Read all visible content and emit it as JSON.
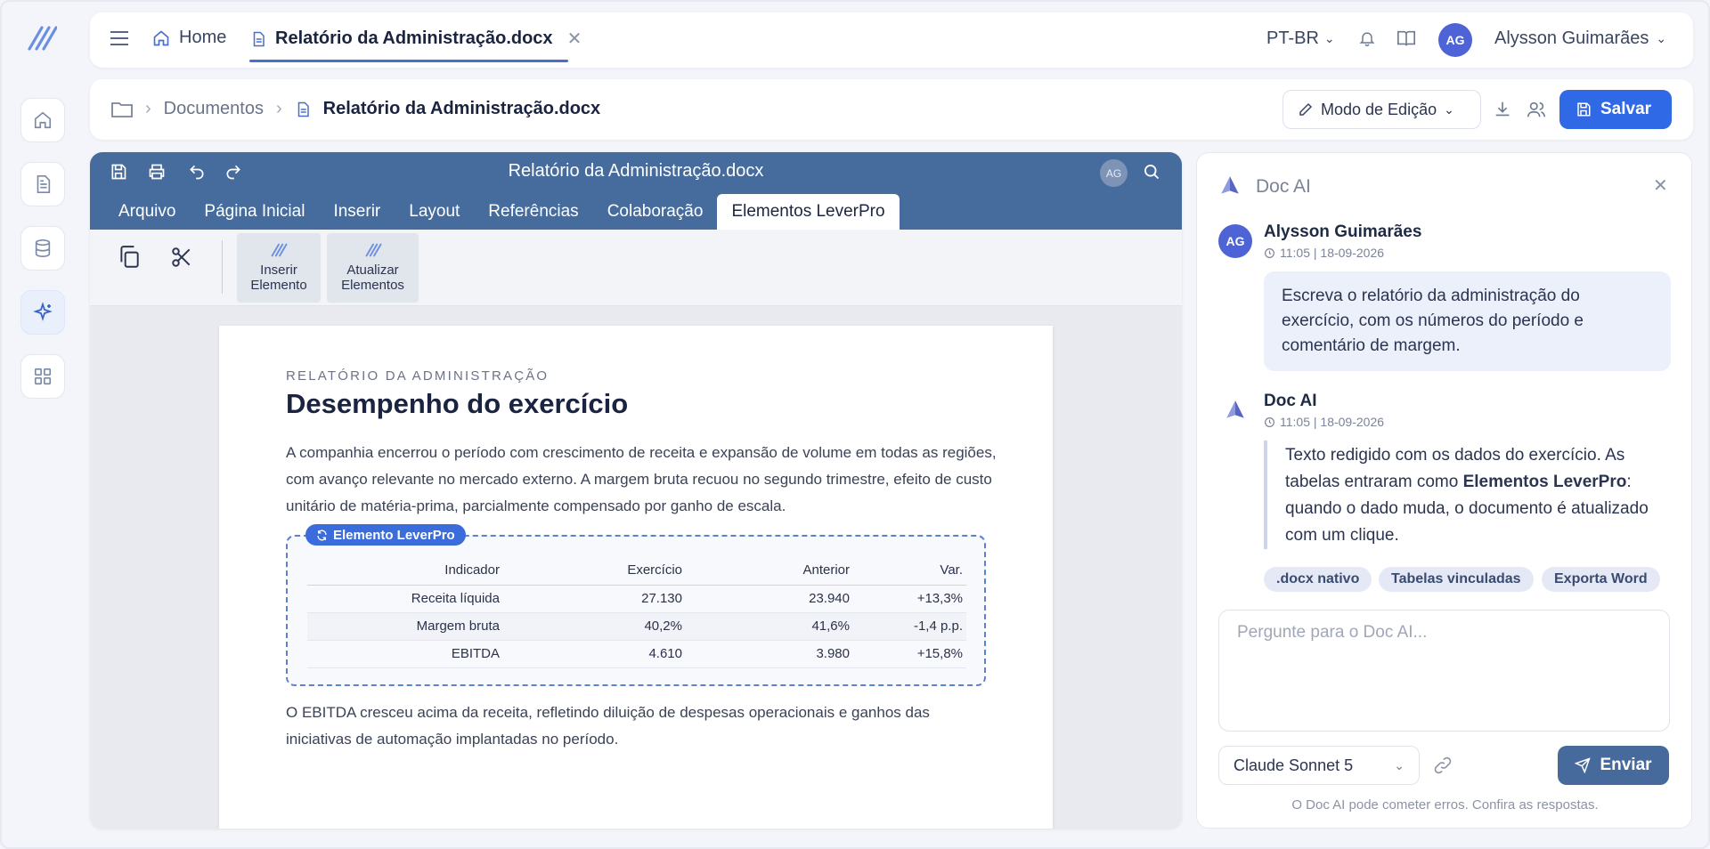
{
  "topbar": {
    "home_label": "Home",
    "doc_tab_label": "Relatório da Administração.docx",
    "language": "PT-BR",
    "user_initials": "AG",
    "user_name": "Alysson Guimarães"
  },
  "breadcrumb": {
    "folder": "Documentos",
    "current": "Relatório da Administração.docx"
  },
  "actions": {
    "mode_label": "Modo de Edição",
    "save_label": "Salvar"
  },
  "editor": {
    "title": "Relatório da Administração.docx",
    "avatar_initials": "AG",
    "menu": [
      "Arquivo",
      "Página Inicial",
      "Inserir",
      "Layout",
      "Referências",
      "Colaboração",
      "Elementos LeverPro"
    ],
    "active_menu": "Elementos LeverPro",
    "ribbon": {
      "insert_label": "Inserir Elemento",
      "update_label": "Atualizar Elementos"
    }
  },
  "document": {
    "kicker": "RELATÓRIO DA ADMINISTRAÇÃO",
    "heading": "Desempenho do exercício",
    "paragraph1": "A companhia encerrou o período com crescimento de receita e expansão de volume em todas as regiões, com avanço relevante no mercado externo. A margem bruta recuou no segundo trimestre, efeito de custo unitário de matéria-prima, parcialmente compensado por ganho de escala.",
    "element_tag": "Elemento LeverPro",
    "table": {
      "headers": [
        "Indicador",
        "Exercício",
        "Anterior",
        "Var."
      ],
      "rows": [
        [
          "Receita líquida",
          "27.130",
          "23.940",
          "+13,3%"
        ],
        [
          "Margem bruta",
          "40,2%",
          "41,6%",
          "-1,4 p.p."
        ],
        [
          "EBITDA",
          "4.610",
          "3.980",
          "+15,8%"
        ]
      ]
    },
    "paragraph2": "O EBITDA cresceu acima da receita, refletindo diluição de despesas operacionais e ganhos das iniciativas de automação implantadas no período."
  },
  "chat": {
    "title": "Doc AI",
    "user": {
      "initials": "AG",
      "name": "Alysson Guimarães",
      "time": "11:05 | 18-09-2026",
      "message": "Escreva o relatório da administração do exercício, com os números do período e comentário de margem."
    },
    "ai": {
      "name": "Doc AI",
      "time": "11:05 | 18-09-2026",
      "text_before": "Texto redigido com os dados do exercício. As tabelas entraram como ",
      "text_bold": "Elementos LeverPro",
      "text_after": ": quando o dado muda, o documento é atualizado com um clique.",
      "chips": [
        ".docx nativo",
        "Tabelas vinculadas",
        "Exporta Word"
      ]
    },
    "input_placeholder": "Pergunte para o Doc AI...",
    "model": "Claude Sonnet 5",
    "send_label": "Enviar",
    "disclaimer": "O Doc AI pode cometer erros. Confira as respostas."
  },
  "colors": {
    "accent": "#3069e6",
    "editor_header": "#456c9d",
    "avatar": "#4d63d6"
  }
}
